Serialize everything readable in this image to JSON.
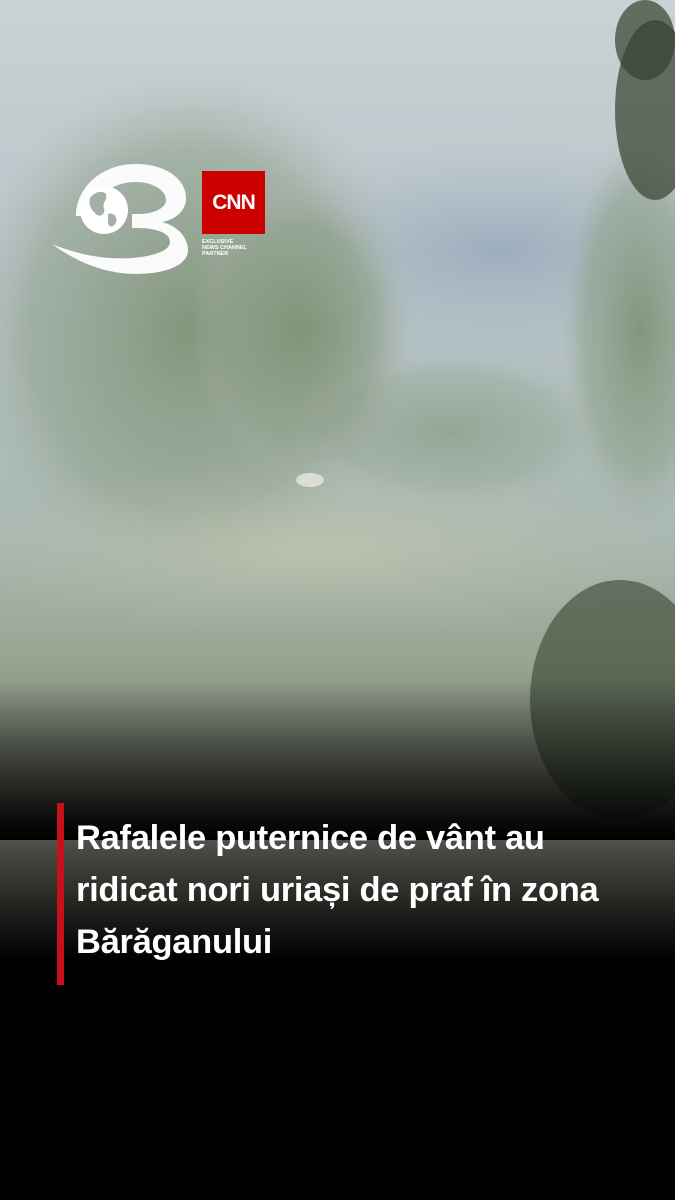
{
  "video": {
    "headline_lines": [
      "Rafalele puternice de vânt au",
      "ridicat nori uriași de praf în zona",
      "Bărăganului"
    ]
  },
  "branding": {
    "channel_logo": "antena-3-globe-logo",
    "cnn_label": "CNN",
    "partner_lines": [
      "EXCLUSIVE",
      "NEWS CHANNEL",
      "PARTNER"
    ]
  },
  "colors": {
    "accent": "#c8101c",
    "cnn_red": "#cc0000",
    "text": "#ffffff",
    "background": "#000000"
  }
}
